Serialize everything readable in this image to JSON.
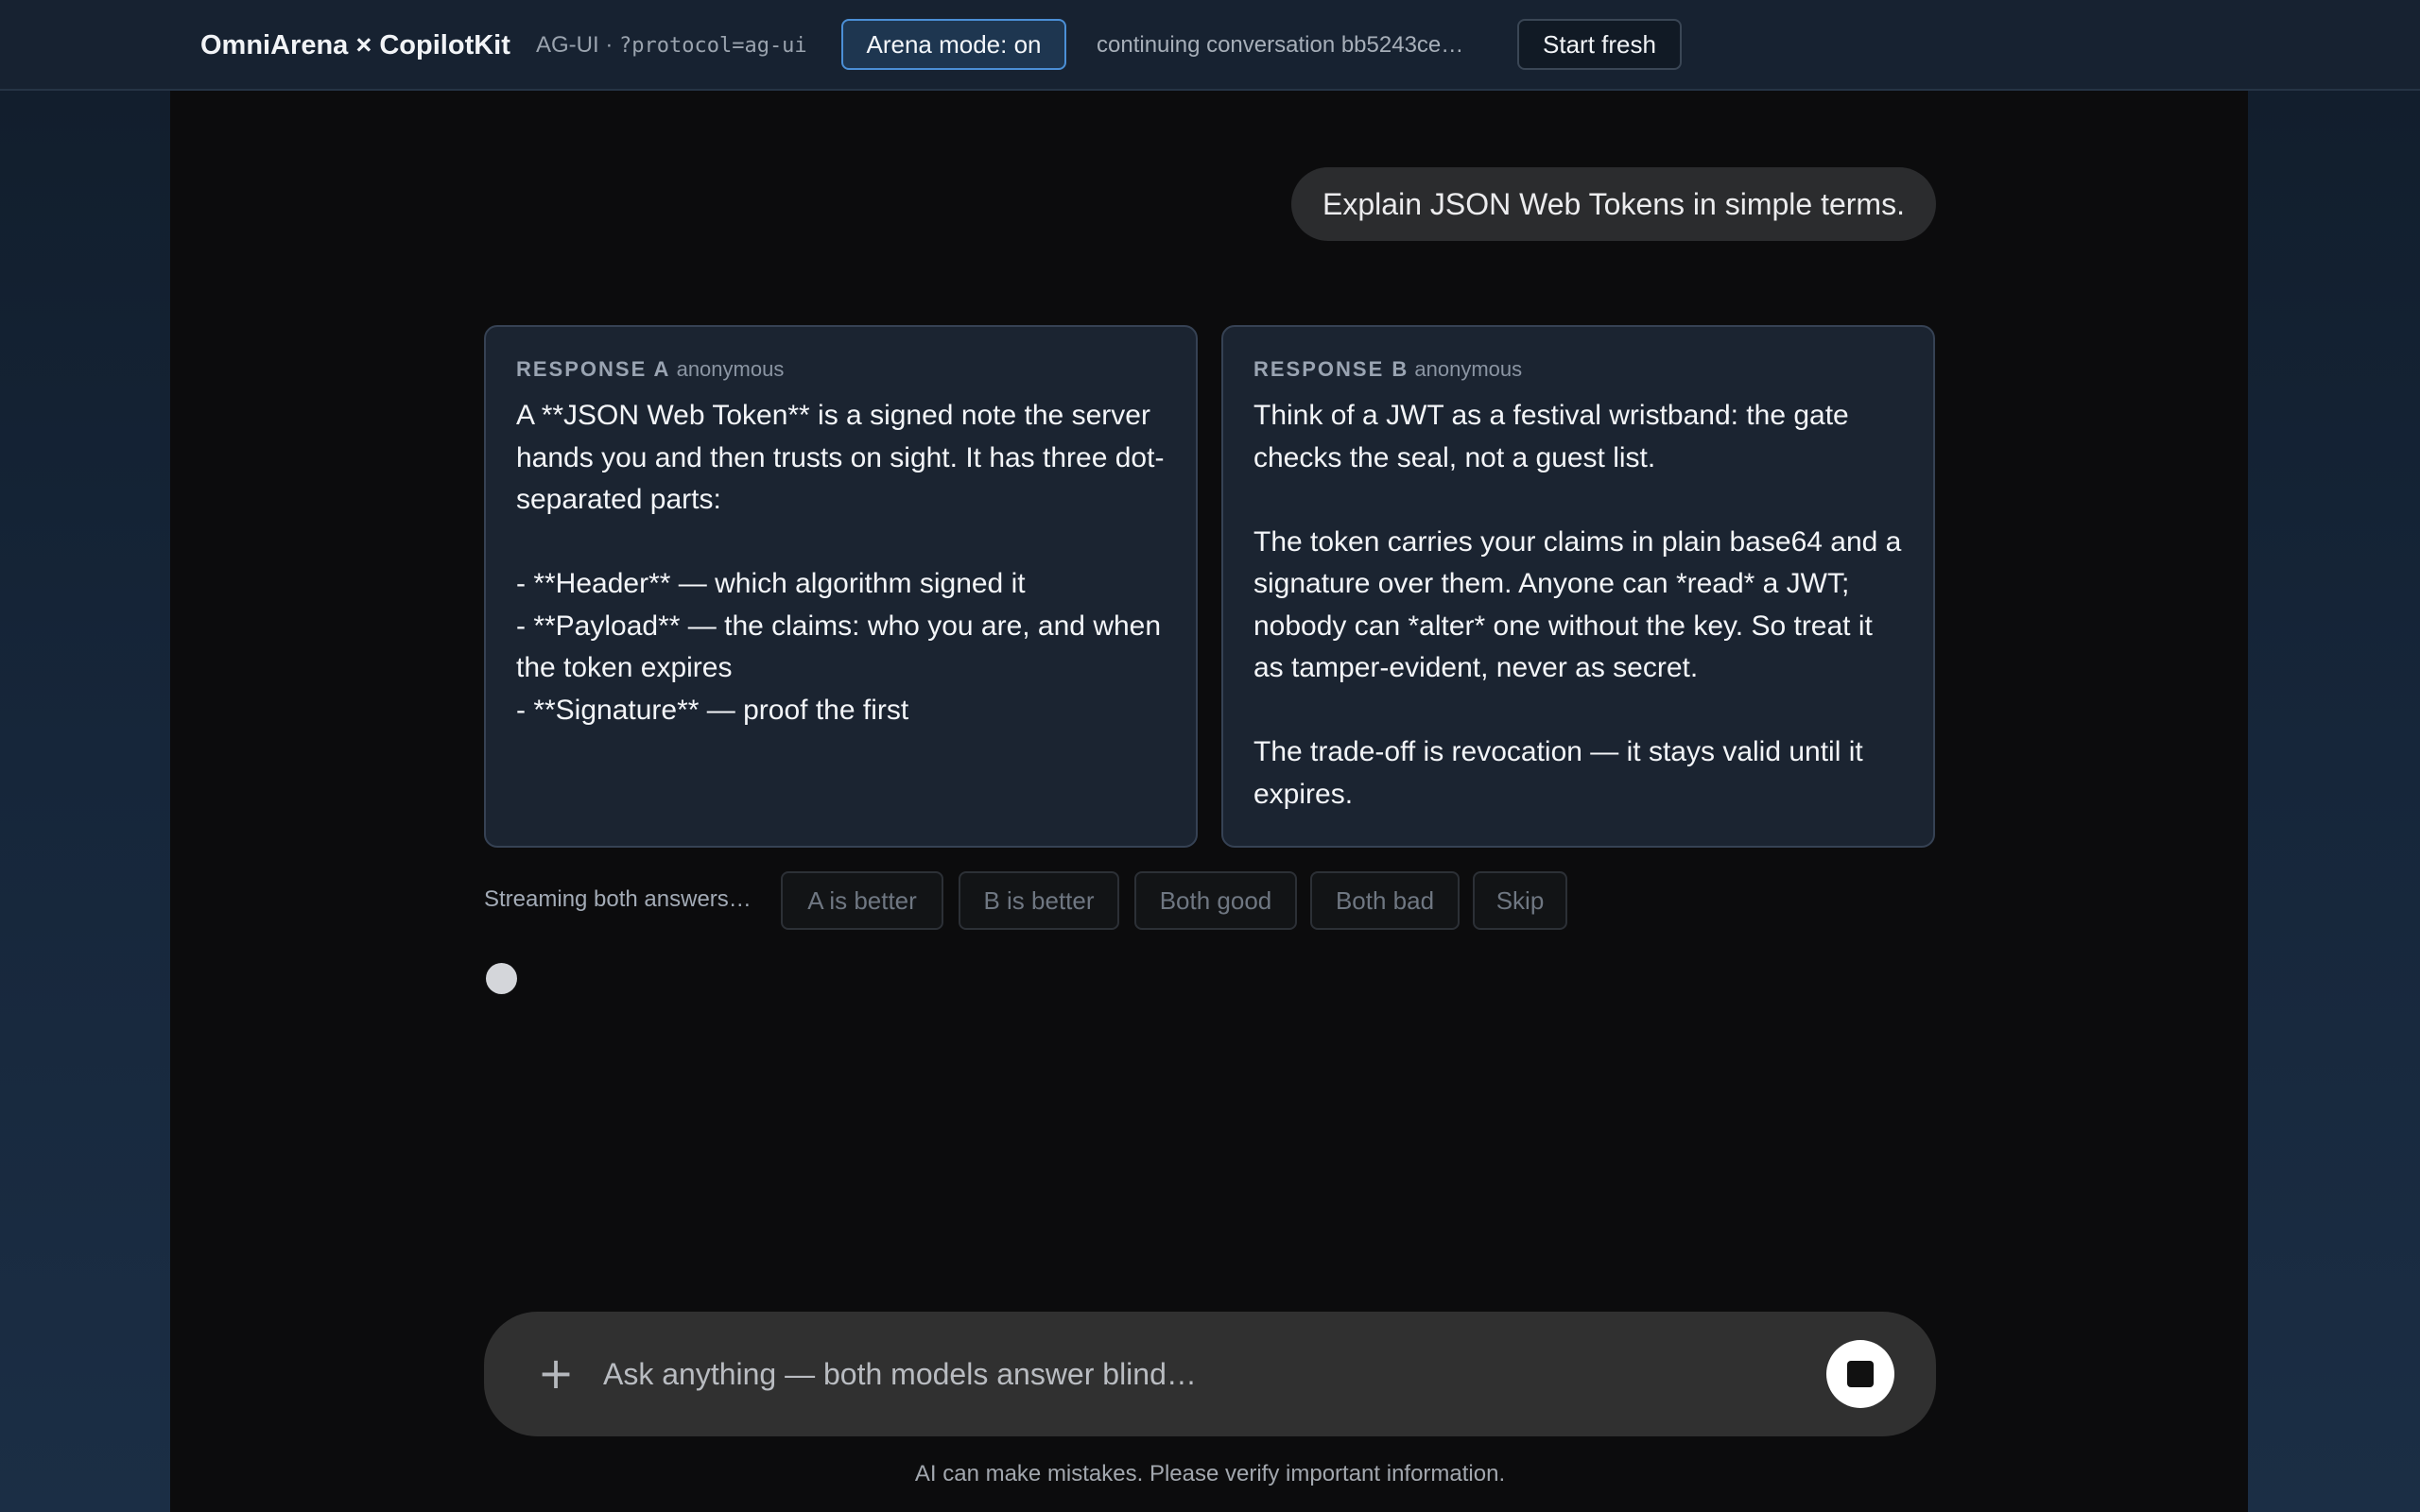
{
  "header": {
    "brand": "OmniArena × CopilotKit",
    "protocol_label": "AG-UI · ",
    "protocol_param": "?protocol=ag-ui",
    "arena_mode_label": "Arena mode: on",
    "conversation_status": "continuing conversation bb5243ce…",
    "start_fresh_label": "Start fresh"
  },
  "chat": {
    "user_message": "Explain JSON Web Tokens in simple terms.",
    "responses": [
      {
        "tag": "RESPONSE A",
        "author": "anonymous",
        "text": "A **JSON Web Token** is a signed note the server hands you and then trusts on sight. It has three dot-separated parts:\n\n- **Header** — which algorithm signed it\n- **Payload** — the claims: who you are, and when the token expires\n- **Signature** — proof the first"
      },
      {
        "tag": "RESPONSE B",
        "author": "anonymous",
        "text": "Think of a JWT as a festival wristband: the gate checks the seal, not a guest list.\n\nThe token carries your claims in plain base64 and a signature over them. Anyone can *read* a JWT; nobody can *alter* one without the key. So treat it as tamper-evident, never as secret.\n\nThe trade-off is revocation — it stays valid until it expires."
      }
    ]
  },
  "voting": {
    "status": "Streaming both answers…",
    "options": [
      "A is better",
      "B is better",
      "Both good",
      "Both bad",
      "Skip"
    ]
  },
  "composer": {
    "placeholder": "Ask anything — both models answer blind…",
    "plus_icon": "plus-icon",
    "stop_icon": "stop-icon"
  },
  "footer": {
    "disclaimer": "AI can make mistakes. Please verify important information."
  },
  "colors": {
    "accent": "#4b8fd6",
    "card_bg": "#1b2431",
    "panel_bg": "#0c0c0d",
    "composer_bg": "#303030"
  }
}
